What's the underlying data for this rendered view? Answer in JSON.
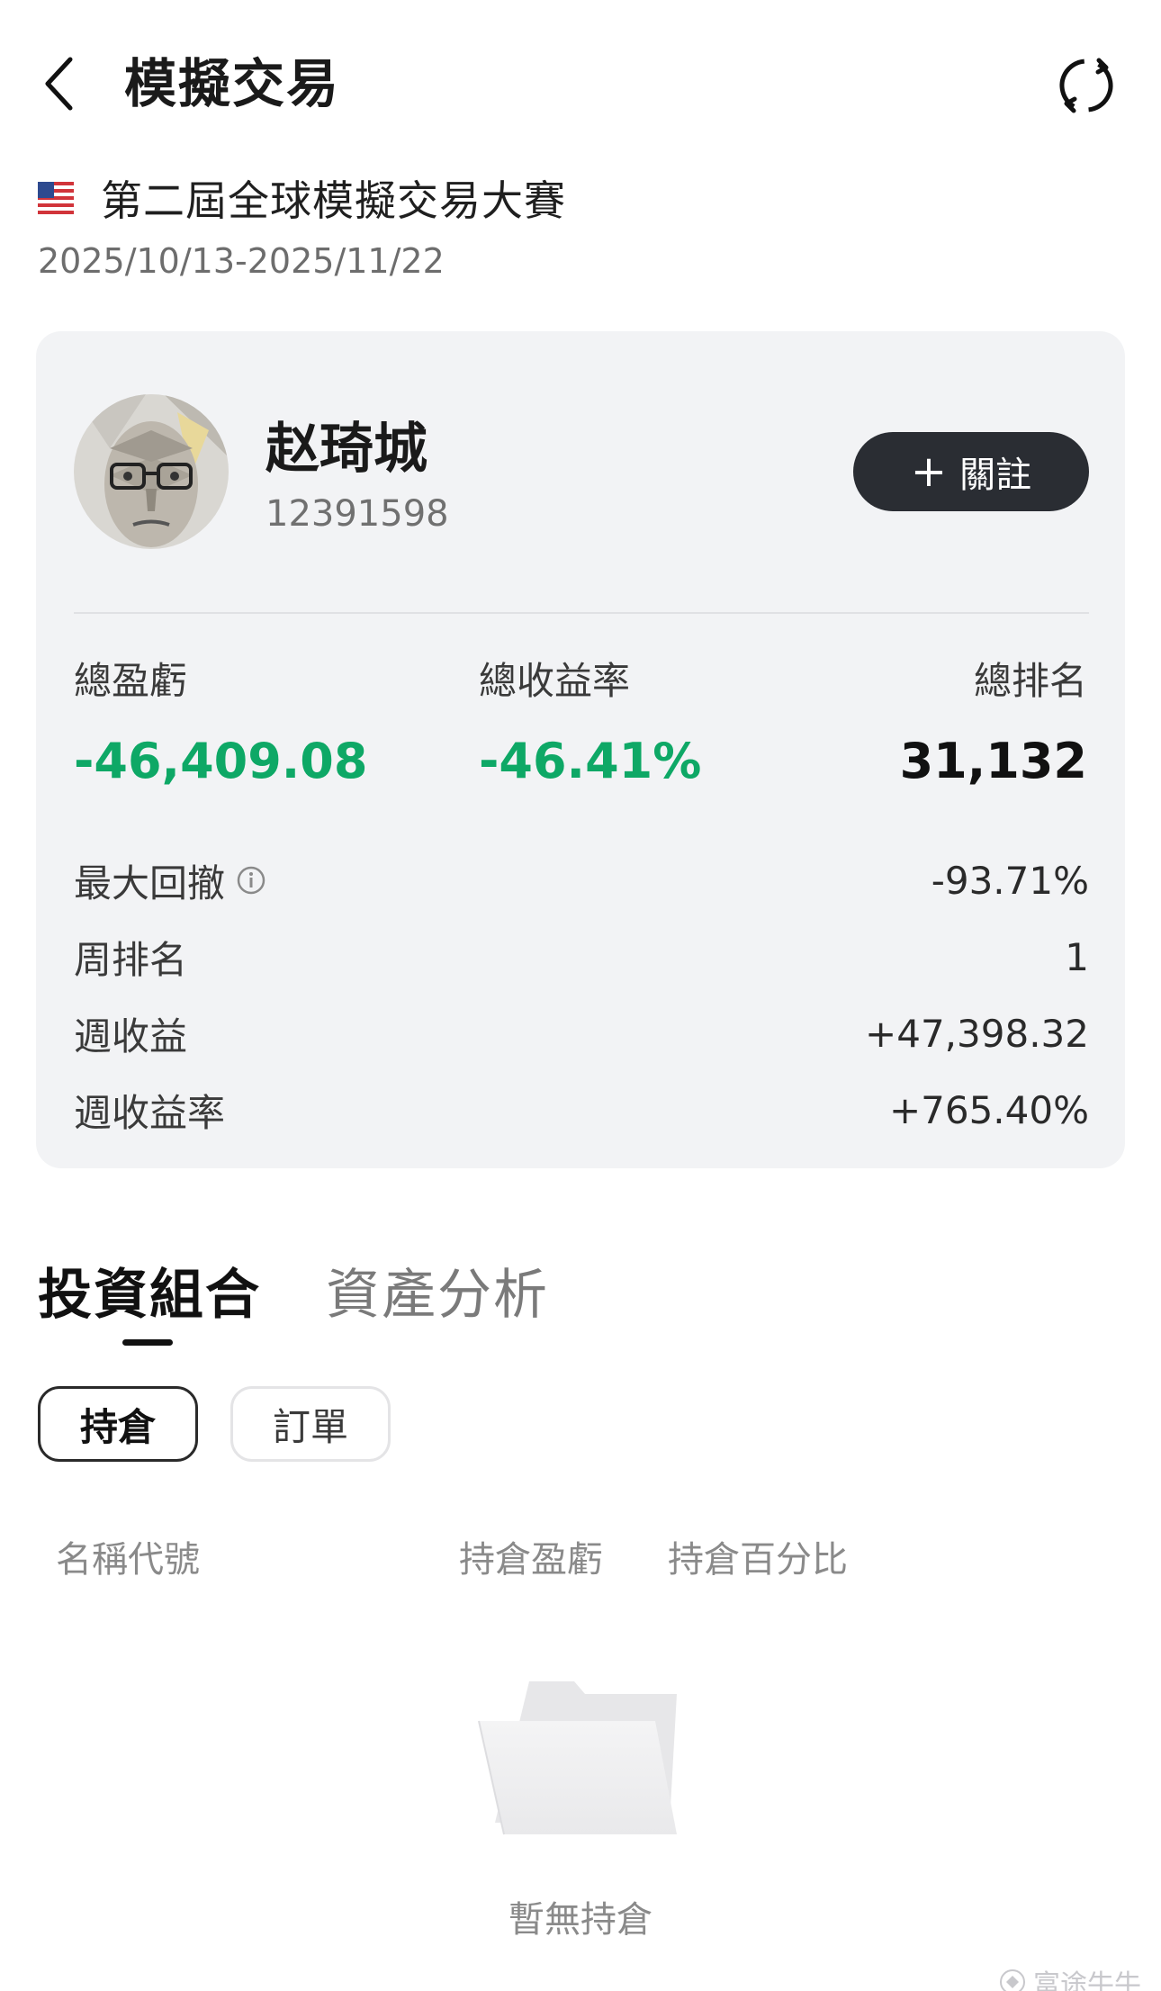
{
  "header": {
    "title": "模擬交易"
  },
  "contest": {
    "name": "第二屆全球模擬交易大賽",
    "date_range": "2025/10/13-2025/11/22"
  },
  "profile": {
    "name": "赵琦城",
    "user_id": "12391598",
    "follow_label": "關註"
  },
  "stats": {
    "total_pl_label": "總盈虧",
    "total_pl_value": "-46,409.08",
    "total_return_label": "總收益率",
    "total_return_value": "-46.41%",
    "total_rank_label": "總排名",
    "total_rank_value": "31,132"
  },
  "details": [
    {
      "label": "最大回撤",
      "value": "-93.71%",
      "color": "#2a2a2a"
    },
    {
      "label": "周排名",
      "value": "1",
      "color": "#2a2a2a"
    },
    {
      "label": "週收益",
      "value": "+47,398.32",
      "color": "#e8304a"
    },
    {
      "label": "週收益率",
      "value": "+765.40%",
      "color": "#e8304a"
    }
  ],
  "tabs": [
    {
      "label": "投資組合",
      "active": true
    },
    {
      "label": "資產分析",
      "active": false
    }
  ],
  "subtabs": {
    "holdings": "持倉",
    "orders": "訂單"
  },
  "columns": {
    "name": "名稱代號",
    "pl": "持倉盈虧",
    "pct": "持倉百分比"
  },
  "empty": {
    "text": "暫無持倉"
  },
  "watermark": {
    "text": "富途牛牛"
  },
  "colors": {
    "gain": "#e8304a",
    "loss": "#0ea866",
    "card_bg": "#f2f3f5",
    "button_dark": "#2a2d33"
  }
}
